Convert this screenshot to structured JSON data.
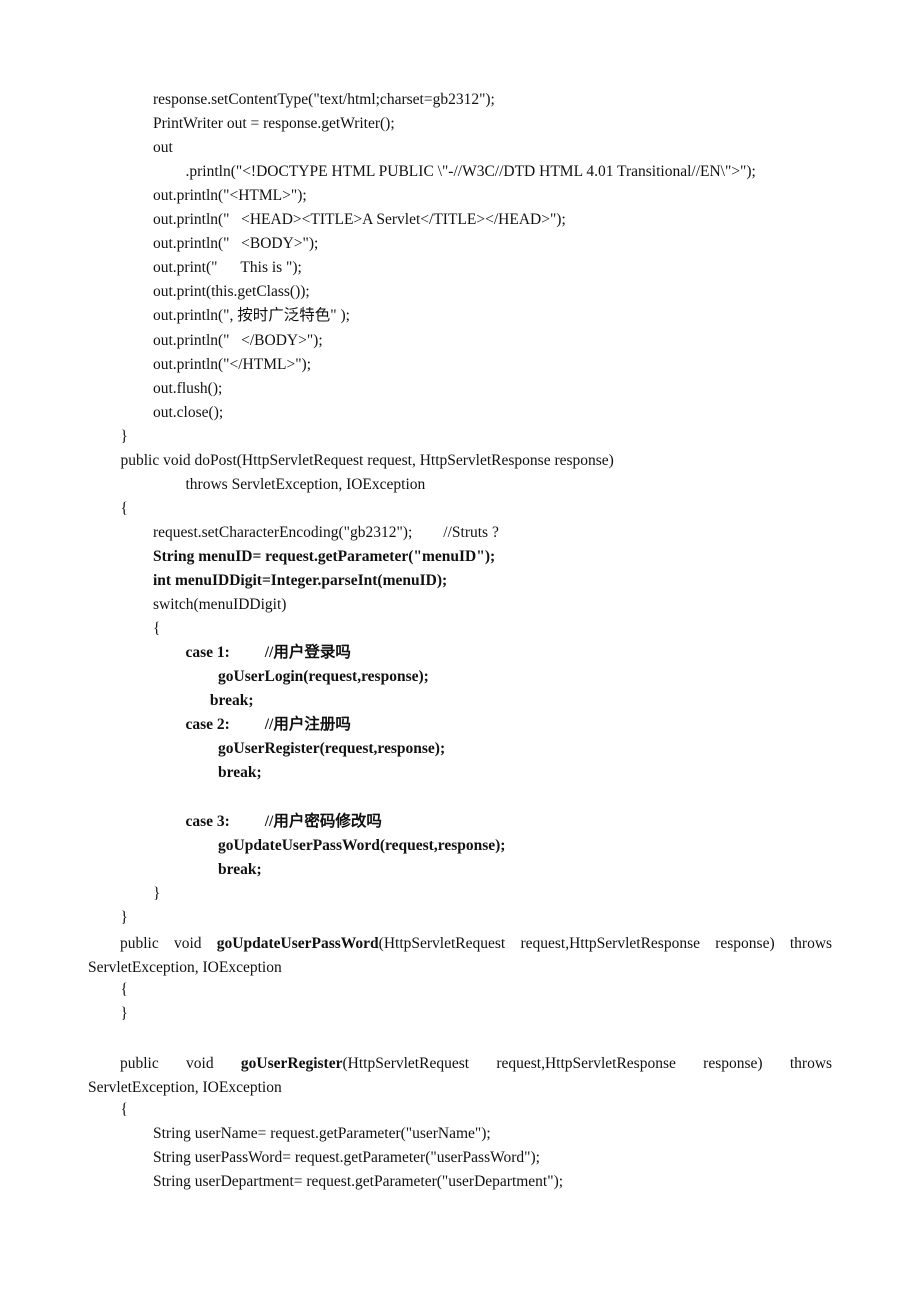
{
  "document": {
    "lines": [
      {
        "text": "response.setContentType(\"text/html;charset=gb2312\");",
        "indent": 2,
        "bold": false,
        "row": 0
      },
      {
        "text": "PrintWriter out = response.getWriter();",
        "indent": 2,
        "bold": false,
        "row": 1
      },
      {
        "text": "out",
        "indent": 2,
        "bold": false,
        "row": 2
      },
      {
        "text": ".println(\"<!DOCTYPE HTML PUBLIC \\\"-//W3C//DTD HTML 4.01 Transitional//EN\\\">\");",
        "indent": 3,
        "bold": false,
        "row": 3
      },
      {
        "text": "out.println(\"<HTML>\");",
        "indent": 2,
        "bold": false,
        "row": 4
      },
      {
        "text": "out.println(\"   <HEAD><TITLE>A Servlet</TITLE></HEAD>\");",
        "indent": 2,
        "bold": false,
        "row": 5
      },
      {
        "text": "out.println(\"   <BODY>\");",
        "indent": 2,
        "bold": false,
        "row": 6
      },
      {
        "text": "out.print(\"      This is \");",
        "indent": 2,
        "bold": false,
        "row": 7
      },
      {
        "text": "out.print(this.getClass());",
        "indent": 2,
        "bold": false,
        "row": 8
      },
      {
        "text": "out.println(\", 按时广泛特色\" );",
        "indent": 2,
        "bold": false,
        "row": 9
      },
      {
        "text": "out.println(\"   </BODY>\");",
        "indent": 2,
        "bold": false,
        "row": 10
      },
      {
        "text": "out.println(\"</HTML>\");",
        "indent": 2,
        "bold": false,
        "row": 11
      },
      {
        "text": "out.flush();",
        "indent": 2,
        "bold": false,
        "row": 12
      },
      {
        "text": "out.close();",
        "indent": 2,
        "bold": false,
        "row": 13
      },
      {
        "text": "}",
        "indent": 1,
        "bold": false,
        "row": 14
      },
      {
        "text": "public void doPost(HttpServletRequest request, HttpServletResponse response)",
        "indent": 1,
        "bold": false,
        "row": 15
      },
      {
        "text": "throws ServletException, IOException",
        "indent": 3,
        "bold": false,
        "row": 16
      },
      {
        "text": "{",
        "indent": 1,
        "bold": false,
        "row": 17
      },
      {
        "text": "request.setCharacterEncoding(\"gb2312\");        //Struts ?",
        "indent": 2,
        "bold": false,
        "row": 18
      },
      {
        "text": "String menuID= request.getParameter(\"menuID\");",
        "indent": 2,
        "bold": true,
        "row": 19
      },
      {
        "text": "int menuIDDigit=Integer.parseInt(menuID);",
        "indent": 2,
        "bold": true,
        "row": 20
      },
      {
        "text": "switch(menuIDDigit)",
        "indent": 2,
        "bold": false,
        "row": 21
      },
      {
        "text": "{",
        "indent": 2,
        "bold": false,
        "row": 22
      },
      {
        "text": "case 1:         //用户登录吗",
        "indent": 3,
        "bold": true,
        "row": 23
      },
      {
        "text": "goUserLogin(request,response);",
        "indent": 4,
        "bold": true,
        "row": 24
      },
      {
        "text": "break;",
        "indent": 3.75,
        "bold": true,
        "row": 25
      },
      {
        "text": "case 2:         //用户注册吗",
        "indent": 3,
        "bold": true,
        "row": 26
      },
      {
        "text": "goUserRegister(request,response);",
        "indent": 4,
        "bold": true,
        "row": 27
      },
      {
        "text": "break;",
        "indent": 4,
        "bold": true,
        "row": 28
      },
      {
        "text": "case 3:         //用户密码修改吗",
        "indent": 3,
        "bold": true,
        "row": 30
      },
      {
        "text": "goUpdateUserPassWord(request,response);",
        "indent": 4,
        "bold": true,
        "row": 31
      },
      {
        "text": "break;",
        "indent": 4,
        "bold": true,
        "row": 32
      },
      {
        "text": "}",
        "indent": 2,
        "bold": false,
        "row": 33
      },
      {
        "text": "}",
        "indent": 1,
        "bold": false,
        "row": 34
      },
      {
        "text": "{",
        "indent": 1,
        "bold": false,
        "row": 37
      },
      {
        "text": "}",
        "indent": 1,
        "bold": false,
        "row": 38
      },
      {
        "text": "{",
        "indent": 1,
        "bold": false,
        "row": 42
      },
      {
        "text": "String userName= request.getParameter(\"userName\");",
        "indent": 2,
        "bold": false,
        "row": 43
      },
      {
        "text": "String userPassWord= request.getParameter(\"userPassWord\");",
        "indent": 2,
        "bold": false,
        "row": 44
      },
      {
        "text": "String userDepartment= request.getParameter(\"userDepartment\");",
        "indent": 2,
        "bold": false,
        "row": 45
      }
    ],
    "method_update": {
      "parts": [
        "public",
        "void",
        "goUpdateUserPassWord",
        "(HttpServletRequest",
        "request,HttpServletResponse",
        "response)",
        "throws"
      ],
      "continuation": "ServletException, IOException"
    },
    "method_register": {
      "parts": [
        "public",
        "void",
        "goUserRegister",
        "(HttpServletRequest",
        "request,HttpServletResponse",
        "response)",
        "throws"
      ],
      "continuation": "ServletException, IOException"
    }
  }
}
